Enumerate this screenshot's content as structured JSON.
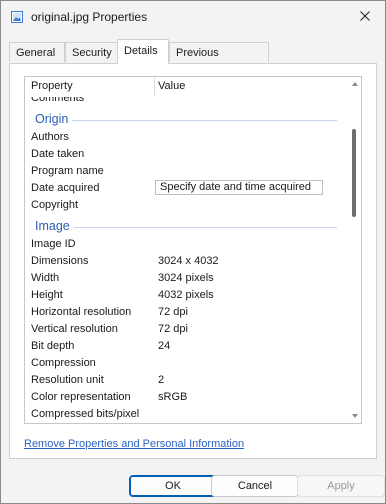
{
  "window": {
    "title": "original.jpg Properties"
  },
  "tabs": [
    {
      "label": "General"
    },
    {
      "label": "Security"
    },
    {
      "label": "Details"
    },
    {
      "label": "Previous Versions"
    }
  ],
  "details": {
    "header": {
      "property": "Property",
      "value": "Value"
    },
    "comments_label": "Comments",
    "origin": {
      "title": "Origin",
      "authors": "Authors",
      "date_taken": "Date taken",
      "program_name": "Program name",
      "date_acquired": "Date acquired",
      "date_acquired_value": "Specify date and time acquired",
      "copyright": "Copyright"
    },
    "image": {
      "title": "Image",
      "image_id": "Image ID",
      "dimensions": "Dimensions",
      "dimensions_value": "3024 x 4032",
      "width": "Width",
      "width_value": "3024 pixels",
      "height": "Height",
      "height_value": "4032 pixels",
      "hres": "Horizontal resolution",
      "hres_value": "72 dpi",
      "vres": "Vertical resolution",
      "vres_value": "72 dpi",
      "bit_depth": "Bit depth",
      "bit_depth_value": "24",
      "compression": "Compression",
      "res_unit": "Resolution unit",
      "res_unit_value": "2",
      "color_rep": "Color representation",
      "color_rep_value": "sRGB",
      "compressed_bits": "Compressed bits/pixel"
    }
  },
  "remove_link": "Remove Properties and Personal Information",
  "buttons": {
    "ok": "OK",
    "cancel": "Cancel",
    "apply": "Apply"
  },
  "colors": {
    "accent": "#005fb8",
    "group_title": "#2b5fb3",
    "link": "#2a63c7"
  },
  "icons": {
    "app": "image-file-icon",
    "close": "close-icon"
  }
}
